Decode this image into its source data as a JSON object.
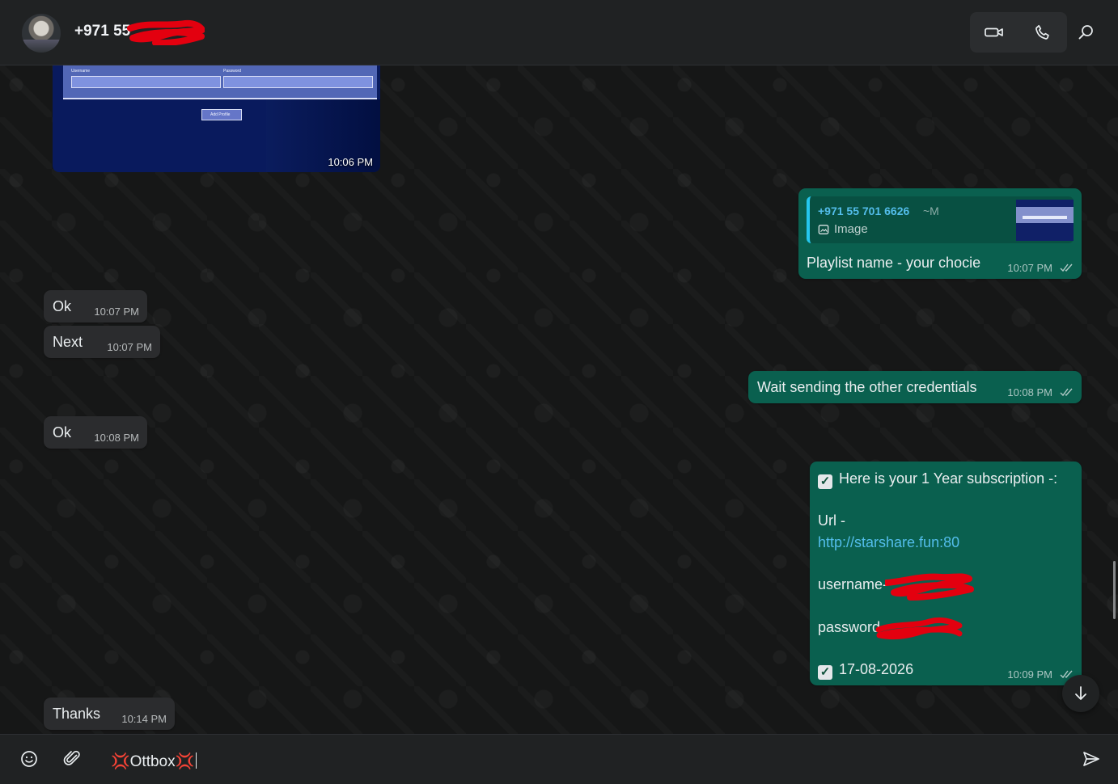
{
  "chat": {
    "contact_name": "+971 55",
    "header_icons": [
      "video-call-icon",
      "phone-call-icon",
      "search-icon"
    ]
  },
  "messages": [
    {
      "kind": "image",
      "direction": "incoming",
      "time": "10:06 PM",
      "preview_labels": [
        "Username",
        "Password",
        "Add Profile"
      ]
    },
    {
      "kind": "reply",
      "direction": "outgoing",
      "reply_sender": "+971 55 701 6626",
      "reply_suffix": "~M",
      "reply_type": "Image",
      "text": "Playlist name - your chocie",
      "time": "10:07 PM"
    },
    {
      "kind": "text",
      "direction": "incoming",
      "text": "Ok",
      "time": "10:07 PM"
    },
    {
      "kind": "text",
      "direction": "incoming",
      "text": "Next",
      "time": "10:07 PM"
    },
    {
      "kind": "text",
      "direction": "outgoing",
      "text": "Wait sending the other credentials",
      "time": "10:08 PM"
    },
    {
      "kind": "text",
      "direction": "incoming",
      "text": "Ok",
      "time": "10:08 PM"
    },
    {
      "kind": "subscription",
      "direction": "outgoing",
      "header": "Here is your 1 Year subscription -:",
      "url_label": "Url -",
      "url": "http://starshare.fun:80",
      "username_label": "username-",
      "password_label": "password-",
      "expiry": "17-08-2026",
      "time": "10:09 PM"
    },
    {
      "kind": "text",
      "direction": "incoming",
      "text": "Thanks",
      "time": "10:14 PM"
    }
  ],
  "composer": {
    "input_value": "💢Ottbox💢",
    "emoji_icon": "emoji-icon",
    "attach_icon": "paperclip-icon",
    "send_icon": "send-icon"
  },
  "colors": {
    "incoming_bubble": "#2b2c2e",
    "outgoing_bubble": "#0a604f",
    "accent_link": "#53bdeb",
    "redaction": "#e3000f"
  }
}
